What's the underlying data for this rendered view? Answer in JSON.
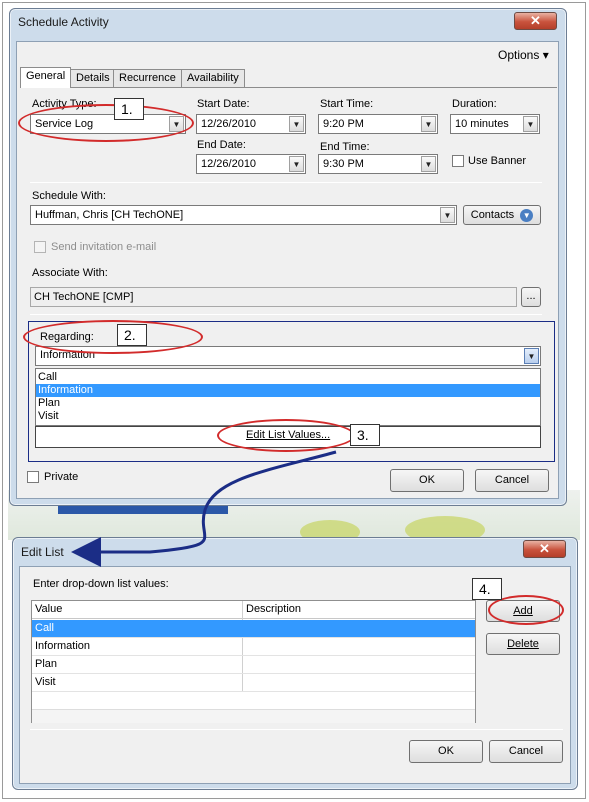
{
  "schedule_activity": {
    "title": "Schedule Activity",
    "close_symbol": "✕",
    "options_label": "Options",
    "options_arrow": "▾",
    "tabs": [
      {
        "label": "General"
      },
      {
        "label": "Details"
      },
      {
        "label": "Recurrence"
      },
      {
        "label": "Availability"
      }
    ],
    "activity_type": {
      "label": "Activity Type:",
      "value": "Service Log"
    },
    "start_date": {
      "label": "Start Date:",
      "value": "12/26/2010"
    },
    "end_date": {
      "label": "End Date:",
      "value": "12/26/2010"
    },
    "start_time": {
      "label": "Start Time:",
      "value": "9:20 PM"
    },
    "end_time": {
      "label": "End Time:",
      "value": "9:30 PM"
    },
    "duration": {
      "label": "Duration:",
      "value": "10 minutes"
    },
    "use_banner_label": "Use Banner",
    "schedule_with": {
      "label": "Schedule With:",
      "value": "Huffman, Chris [CH TechONE]"
    },
    "contacts_button": "Contacts",
    "send_invitation_label": "Send invitation e-mail",
    "associate_with": {
      "label": "Associate With:",
      "value": "CH TechONE [CMP]"
    },
    "browse_button": "...",
    "regarding": {
      "label": "Regarding:",
      "value": "Information",
      "options": [
        "Call",
        "Information",
        "Plan",
        "Visit"
      ],
      "selected_index": 1,
      "edit_list_button": "Edit List Values..."
    },
    "private_label": "Private",
    "ok_button": "OK",
    "cancel_button": "Cancel"
  },
  "edit_list": {
    "title": "Edit List",
    "close_symbol": "✕",
    "instruction": "Enter drop-down list values:",
    "columns": [
      "Value",
      "Description"
    ],
    "rows": [
      {
        "value": "Call",
        "description": ""
      },
      {
        "value": "Information",
        "description": ""
      },
      {
        "value": "Plan",
        "description": ""
      },
      {
        "value": "Visit",
        "description": ""
      }
    ],
    "selected_row": 0,
    "add_button": "Add",
    "delete_button": "Delete",
    "ok_button": "OK",
    "cancel_button": "Cancel"
  },
  "annotations": [
    "1.",
    "2.",
    "3.",
    "4."
  ],
  "colors": {
    "annotation_ring": "#d22b2b",
    "arrow": "#1b2d86",
    "selection": "#3399ff"
  }
}
